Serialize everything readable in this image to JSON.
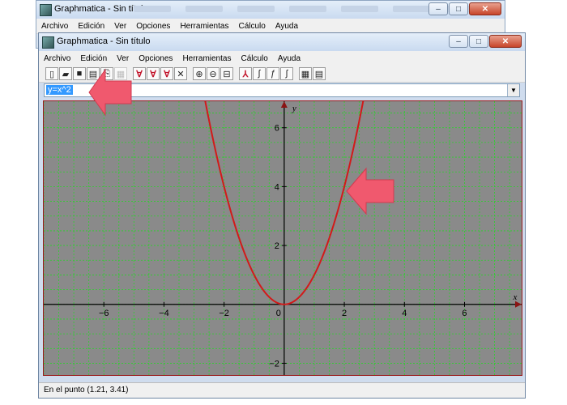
{
  "back_window": {
    "title": "Graphmatica - Sin título",
    "menu": [
      "Archivo",
      "Edición",
      "Ver",
      "Opciones",
      "Herramientas",
      "Cálculo",
      "Ayuda"
    ]
  },
  "window": {
    "title": "Graphmatica - Sin título",
    "menu": [
      "Archivo",
      "Edición",
      "Ver",
      "Opciones",
      "Herramientas",
      "Cálculo",
      "Ayuda"
    ],
    "equation": "y=x^2",
    "status": "En el punto (1.21, 3.41)"
  },
  "toolbar_icons": [
    "new-icon",
    "open-icon",
    "save-icon",
    "print-icon",
    "copy-icon",
    "grid-icon",
    "plot-icon",
    "derivative-icon",
    "tangent-icon",
    "delete-icon",
    "zoom-in-icon",
    "zoom-out-icon",
    "zoom-fit-icon",
    "axes-icon",
    "integral-icon",
    "function-icon",
    "fx-icon",
    "table-icon",
    "settings-icon"
  ],
  "colors": {
    "plot_background": "#8a8a8a",
    "grid": "#2bd12b",
    "curve": "#d21a1a",
    "axis": "#000000",
    "arrow": "#f0596e"
  },
  "chart_data": {
    "type": "line",
    "equation": "y=x^2",
    "xlim": [
      -8.0,
      7.9
    ],
    "ylim": [
      -2.4,
      6.9
    ],
    "grid": true,
    "grid_step": 0.5,
    "xticks": [
      -6,
      -4,
      -2,
      0,
      2,
      4,
      6
    ],
    "yticks": [
      -2,
      2,
      4,
      6
    ],
    "x_tick_labels": [
      "−6",
      "−4",
      "−2",
      "0",
      "2",
      "4",
      "6"
    ],
    "y_tick_labels": [
      "−2",
      "2",
      "4",
      "6"
    ],
    "xlabel": "x",
    "ylabel": "y"
  }
}
